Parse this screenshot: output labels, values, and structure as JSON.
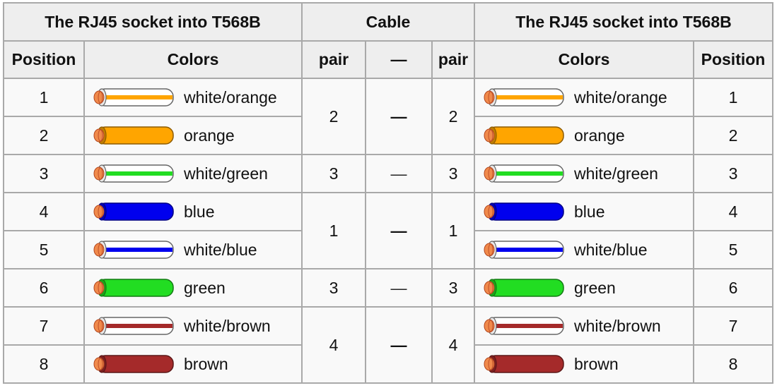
{
  "headers": {
    "left_group": "The RJ45 socket into T568B",
    "cable_group": "Cable",
    "right_group": "The RJ45 socket into T568B",
    "position_left": "Position",
    "colors_left": "Colors",
    "pair_left": "pair",
    "dash": "—",
    "pair_right": "pair",
    "colors_right": "Colors",
    "position_right": "Position"
  },
  "wire_colors": {
    "orange": "#FFA500",
    "green": "#22DD22",
    "blue": "#0000EE",
    "brown": "#A52A2A",
    "white": "#FFFFFF",
    "copper": "#F08A4B"
  },
  "rows": [
    {
      "position": "1",
      "label": "white/orange",
      "base": "white",
      "stripe": "orange"
    },
    {
      "position": "2",
      "label": "orange",
      "base": "orange",
      "stripe": null
    },
    {
      "position": "3",
      "label": "white/green",
      "base": "white",
      "stripe": "green"
    },
    {
      "position": "4",
      "label": "blue",
      "base": "blue",
      "stripe": null
    },
    {
      "position": "5",
      "label": "white/blue",
      "base": "white",
      "stripe": "blue"
    },
    {
      "position": "6",
      "label": "green",
      "base": "green",
      "stripe": null
    },
    {
      "position": "7",
      "label": "white/brown",
      "base": "white",
      "stripe": "brown"
    },
    {
      "position": "8",
      "label": "brown",
      "base": "brown",
      "stripe": null
    }
  ],
  "pairs": [
    {
      "rows": "1-2",
      "left": "2",
      "dash": "—",
      "right": "2"
    },
    {
      "rows": "3",
      "left": "3",
      "dash": "—",
      "right": "3"
    },
    {
      "rows": "4-5",
      "left": "1",
      "dash": "—",
      "right": "1"
    },
    {
      "rows": "6",
      "left": "3",
      "dash": "—",
      "right": "3"
    },
    {
      "rows": "7-8",
      "left": "4",
      "dash": "—",
      "right": "4"
    }
  ]
}
